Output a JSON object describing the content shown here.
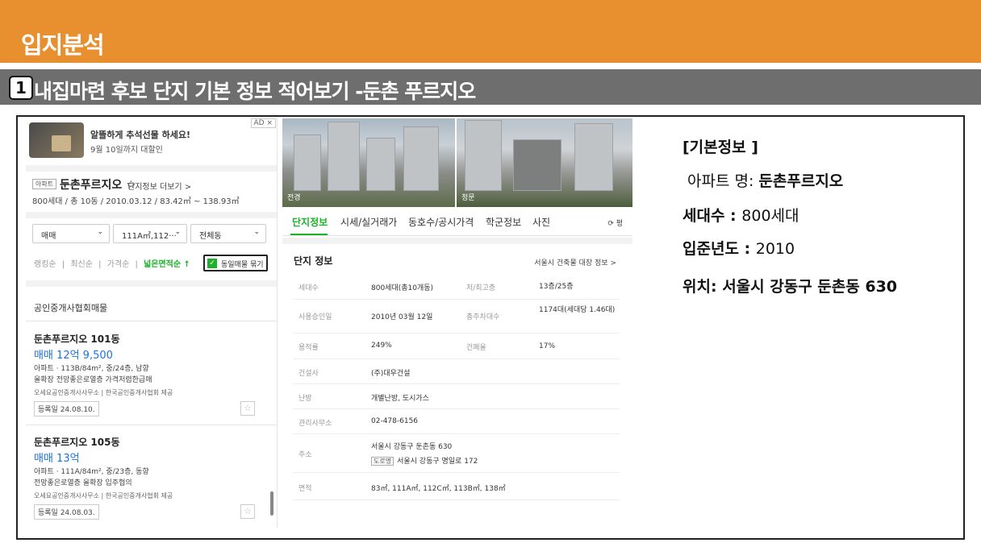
{
  "slide": {
    "title": "입지분석",
    "section_number": "1",
    "section_title": "내집마련 후보 단지 기본 정보 적어보기 -둔촌 푸르지오"
  },
  "ad": {
    "title": "알뜰하게 추석선물 하세요!",
    "subtitle": "9월 10일까지 대할인",
    "tag": "AD ×"
  },
  "complex": {
    "badge": "아파트",
    "name": "둔촌푸르지오 ☆",
    "more_link": "단지정보 더보기 >",
    "meta": "800세대 / 총 10동 / 2010.03.12 / 83.42㎡ ~ 138.93㎡"
  },
  "filters": {
    "trade": "매매",
    "area": "111A㎡,112···",
    "building": "전체동",
    "chevron": "⌄"
  },
  "sort": {
    "items": [
      "랭킹순",
      "|",
      "최신순",
      "|",
      "가격순",
      "|"
    ],
    "active": "넓은면적순 ↑",
    "same_listing": "동일매물 묶기",
    "checkmark": "✓"
  },
  "listings_header": "공인중개사협회매물",
  "listings": [
    {
      "name": "둔촌푸르지오 101동",
      "price": "매매 12억 9,500",
      "spec": "아파트 · 113B/84m², 중/24층, 남향",
      "desc": "올확장 전망좋은로열층 가격저렴한급매",
      "agent": "오세요공인중개사사무소 | 한국공인중개사협회 제공",
      "date": "등록일 24.08.10.",
      "star": "☆"
    },
    {
      "name": "둔촌푸르지오 105동",
      "price": "매매 13억",
      "spec": "아파트 · 111A/84m², 중/23층, 동향",
      "desc": "전망좋은로열층 올확장 입주협의",
      "agent": "오세요공인중개사사무소 | 한국공인중개사협회 제공",
      "date": "등록일 24.08.03.",
      "star": "☆"
    }
  ],
  "photos": {
    "caption_a": "전경",
    "caption_b": "정문"
  },
  "tabs": {
    "items": [
      "단지정보",
      "시세/실거래가",
      "동호수/공시가격",
      "학군정보",
      "사진"
    ],
    "refresh": "⟳ 평"
  },
  "info": {
    "heading": "단지 정보",
    "link": "서울시 건축물 대장 정보 >",
    "rows": {
      "households_key": "세대수",
      "households_val": "800세대(총10개동)",
      "floors_key": "저/최고층",
      "floors_val": "13층/25층",
      "approval_key": "사용승인일",
      "approval_val": "2010년 03월 12일",
      "parking_key": "총주차대수",
      "parking_val": "1174대(세대당 1.46대)",
      "far_key": "용적률",
      "far_val": "249%",
      "bcr_key": "건폐율",
      "bcr_val": "17%",
      "builder_key": "건설사",
      "builder_val": "(주)대우건설",
      "heating_key": "난방",
      "heating_val": "개별난방, 도시가스",
      "office_key": "관리사무소",
      "office_val": "02-478-6156",
      "address_key": "주소",
      "address_val": "서울시 강동구 둔촌동 630",
      "road_tag": "도로명",
      "road_val": "서울시 강동구 명일로 172",
      "area_key": "면적",
      "area_val": "83㎡, 111A㎡, 112C㎡, 113B㎡, 138㎡"
    }
  },
  "basic_info": {
    "heading": "[기본정보 ]",
    "apt_label": "아파트 명: ",
    "apt_value": "둔촌푸르지오",
    "households_label": "세대수 : ",
    "households_value": "800세대",
    "year_label": "입준년도 : ",
    "year_value": "2010",
    "location_label": "위치: ",
    "location_value": "서울시 강동구 둔촌동 630"
  },
  "colors": {
    "header_orange": "#e8902f",
    "section_gray": "#6e6e6e",
    "naver_green": "#1db12b",
    "price_blue": "#1a73e8"
  }
}
